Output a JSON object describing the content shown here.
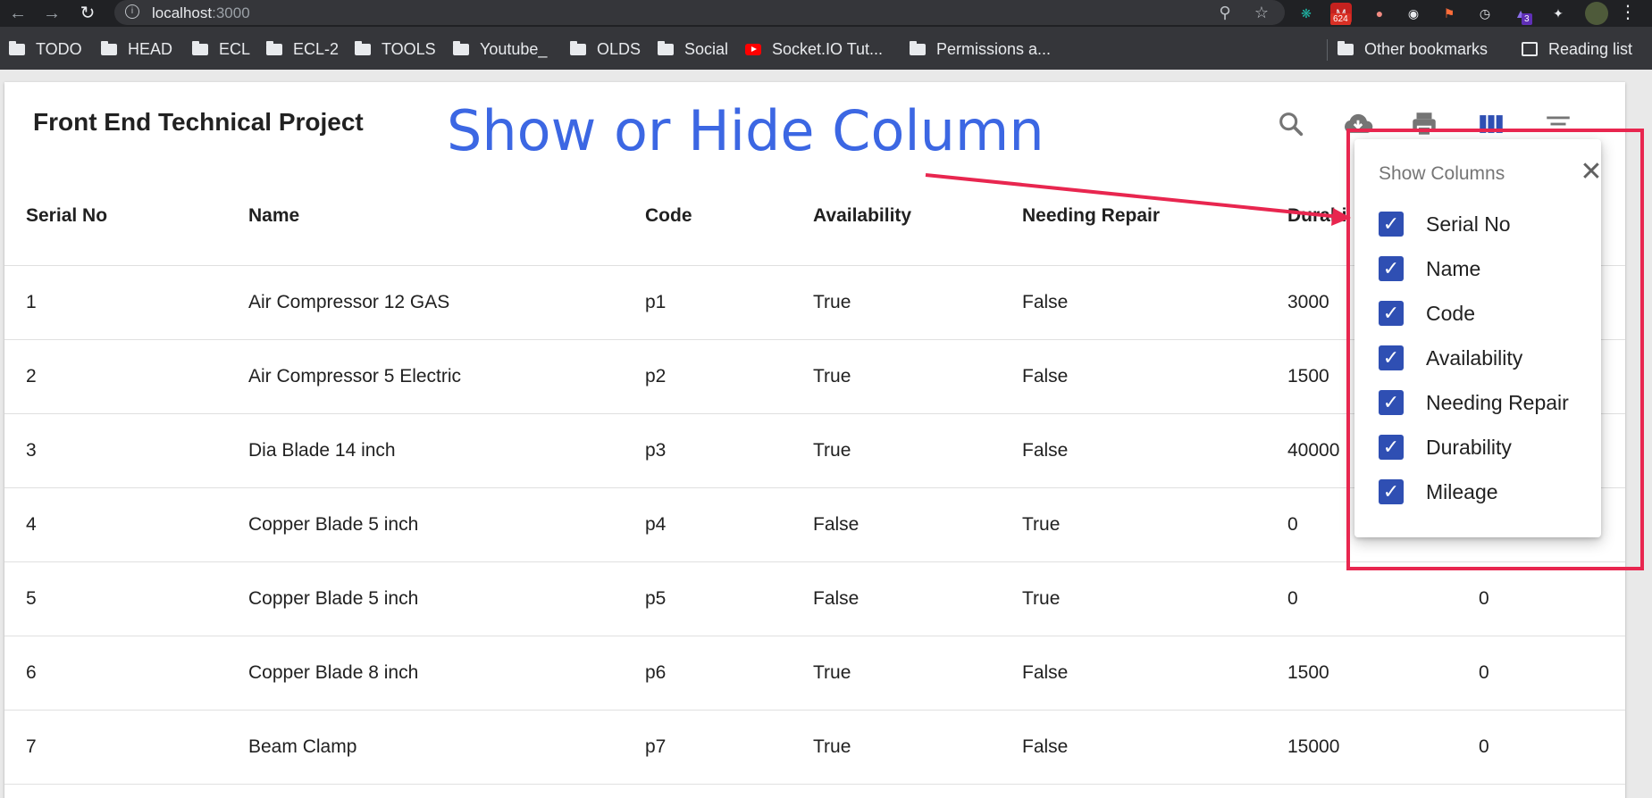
{
  "browser": {
    "url_host": "localhost",
    "url_port": ":3000",
    "extension_badge_mail": "624",
    "extension_badge_other": "3",
    "icons": [
      "back-arrow-icon",
      "forward-arrow-icon",
      "reload-icon",
      "info-icon",
      "zoom-icon",
      "star-icon",
      "puzzle-icon",
      "menu-icon"
    ]
  },
  "bookmarks": {
    "items": [
      {
        "label": "TODO",
        "icon": "folder-icon"
      },
      {
        "label": "HEAD",
        "icon": "folder-icon"
      },
      {
        "label": "ECL",
        "icon": "folder-icon"
      },
      {
        "label": "ECL-2",
        "icon": "folder-icon"
      },
      {
        "label": "TOOLS",
        "icon": "folder-icon"
      },
      {
        "label": "Youtube_",
        "icon": "folder-icon"
      },
      {
        "label": "OLDS",
        "icon": "folder-icon"
      },
      {
        "label": "Social",
        "icon": "folder-icon"
      },
      {
        "label": "Socket.IO Tut...",
        "icon": "youtube-icon"
      },
      {
        "label": "Permissions a...",
        "icon": "folder-icon"
      }
    ],
    "other_bookmarks": "Other bookmarks",
    "reading_list": "Reading list"
  },
  "page": {
    "title": "Front End Technical Project",
    "overlay_caption": "Show or Hide Column",
    "toolbar_icons": [
      "search-icon",
      "download-icon",
      "print-icon",
      "view-columns-icon",
      "filter-icon"
    ]
  },
  "table": {
    "headers": [
      "Serial No",
      "Name",
      "Code",
      "Availability",
      "Needing Repair",
      "Durabi"
    ],
    "rows": [
      [
        "1",
        "Air Compressor 12 GAS",
        "p1",
        "True",
        "False",
        "3000",
        ""
      ],
      [
        "2",
        "Air Compressor 5 Electric",
        "p2",
        "True",
        "False",
        "1500",
        ""
      ],
      [
        "3",
        "Dia Blade 14 inch",
        "p3",
        "True",
        "False",
        "40000",
        ""
      ],
      [
        "4",
        "Copper Blade 5 inch",
        "p4",
        "False",
        "True",
        "0",
        ""
      ],
      [
        "5",
        "Copper Blade 5 inch",
        "p5",
        "False",
        "True",
        "0",
        "0"
      ],
      [
        "6",
        "Copper Blade 8 inch",
        "p6",
        "True",
        "False",
        "1500",
        "0"
      ],
      [
        "7",
        "Beam Clamp",
        "p7",
        "True",
        "False",
        "15000",
        "0"
      ]
    ]
  },
  "show_columns": {
    "title": "Show Columns",
    "close_icon": "close-icon",
    "options": [
      {
        "label": "Serial No",
        "checked": true
      },
      {
        "label": "Name",
        "checked": true
      },
      {
        "label": "Code",
        "checked": true
      },
      {
        "label": "Availability",
        "checked": true
      },
      {
        "label": "Needing Repair",
        "checked": true
      },
      {
        "label": "Durability",
        "checked": true
      },
      {
        "label": "Mileage",
        "checked": true
      }
    ]
  },
  "colors": {
    "accent": "#2f4fb3",
    "caption": "#3c67e3",
    "annotation": "#e8264f"
  }
}
